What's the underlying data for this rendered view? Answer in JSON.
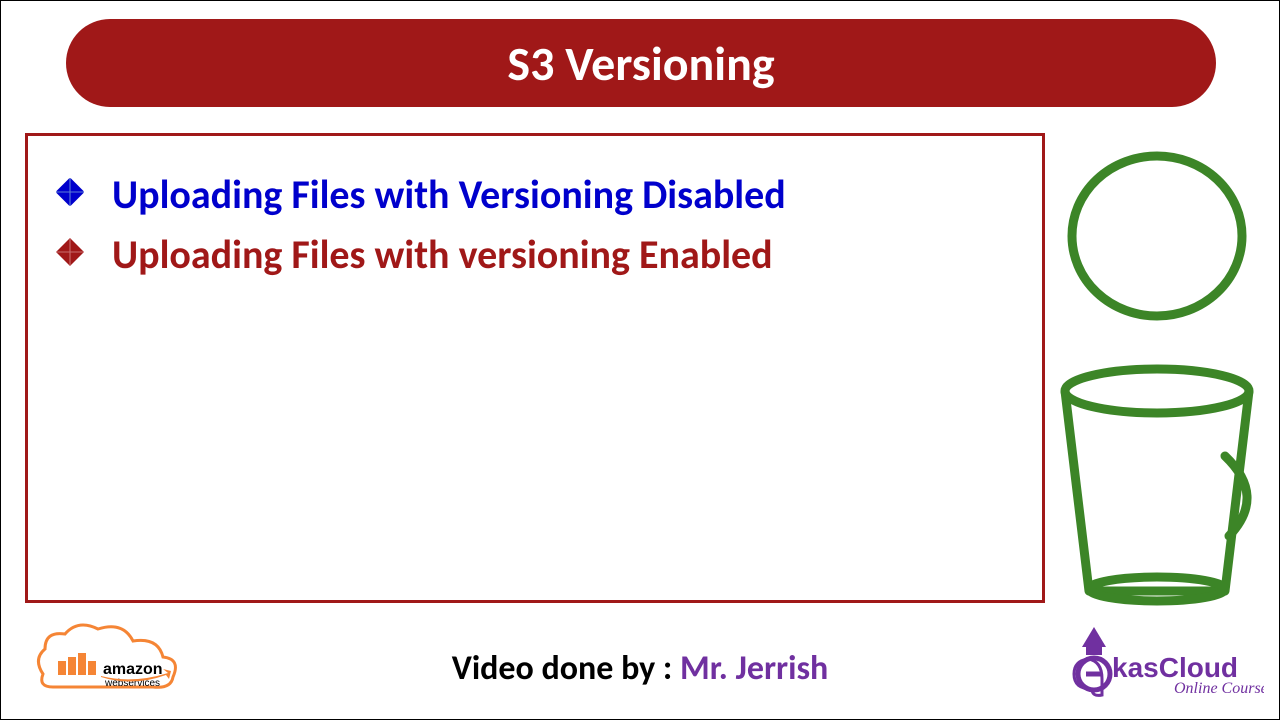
{
  "title": "S3 Versioning",
  "bullets": [
    {
      "text": "Uploading Files with Versioning Disabled",
      "color": "blue"
    },
    {
      "text": "Uploading Files with versioning Enabled",
      "color": "red"
    }
  ],
  "credit": {
    "label": "Video done by : ",
    "name": "Mr. Jerrish"
  },
  "logos": {
    "aws": "amazon webservices",
    "ekas": "EkasCloud Online Courses"
  },
  "colors": {
    "banner": "#a01818",
    "blue": "#0000cc",
    "purple": "#7030a0",
    "green": "#3c8527"
  }
}
